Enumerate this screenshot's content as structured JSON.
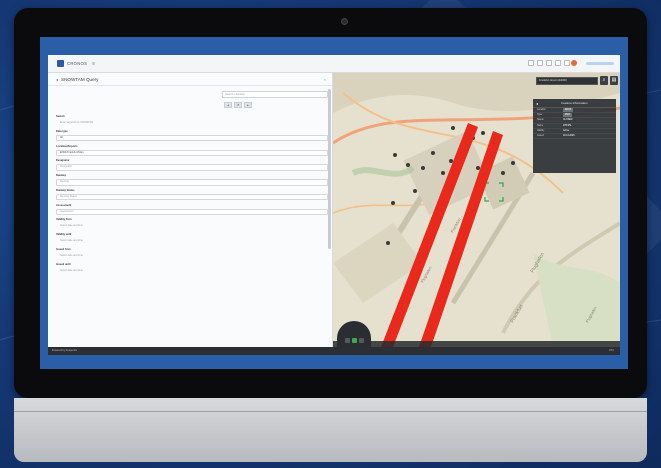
{
  "app": {
    "name": "CRONOS",
    "menu_icon": "hamburger-icon"
  },
  "panel": {
    "title": "SNOWTAM Query",
    "search_placeholder": "Search a location",
    "fields": [
      {
        "label": "Search",
        "value": "Enter keyword for SNOWTAM",
        "style": "plain"
      },
      {
        "label": "Data type",
        "value": "All",
        "style": "filled"
      },
      {
        "label": "Location/Airports",
        "value": "EDDF/Frankfurt/Main",
        "style": "filled"
      },
      {
        "label": "Designator",
        "value": "Designator",
        "style": "normal"
      },
      {
        "label": "Runway",
        "value": "Runway",
        "style": "normal"
      },
      {
        "label": "Runway Status",
        "value": "Runway Status",
        "style": "normal"
      },
      {
        "label": "Assessment",
        "value": "Assessment",
        "style": "normal"
      },
      {
        "label": "Validity from",
        "value": "Select date and time",
        "style": "plain"
      },
      {
        "label": "Validity until",
        "value": "Select date and time",
        "style": "plain"
      },
      {
        "label": "Issued from",
        "value": "Select date and time",
        "style": "plain"
      },
      {
        "label": "Issued until",
        "value": "Select date and time",
        "style": "plain"
      }
    ]
  },
  "map": {
    "search_text": "Frankfurt Airport (EDDF)",
    "labels": [
      "Flughafen",
      "Frankfurt",
      "Frankfurt",
      "Flughafen",
      "Flughafen"
    ],
    "feature_info": {
      "title": "Feature Information",
      "rows": [
        {
          "key": "Location",
          "value": "EDDF"
        },
        {
          "key": "Type",
          "value": "RWY"
        },
        {
          "key": "Status",
          "value": "CLOSED"
        },
        {
          "key": "Name",
          "value": "07R/25L"
        },
        {
          "key": "Validity",
          "value": "Active"
        },
        {
          "key": "Issued",
          "value": "18.12.2020"
        }
      ]
    }
  },
  "footer": {
    "left": "Powered by frequentis",
    "right": "UTC"
  },
  "colors": {
    "runway": "#e8291c",
    "background": "#163a78",
    "accent": "#2d5aa8"
  }
}
